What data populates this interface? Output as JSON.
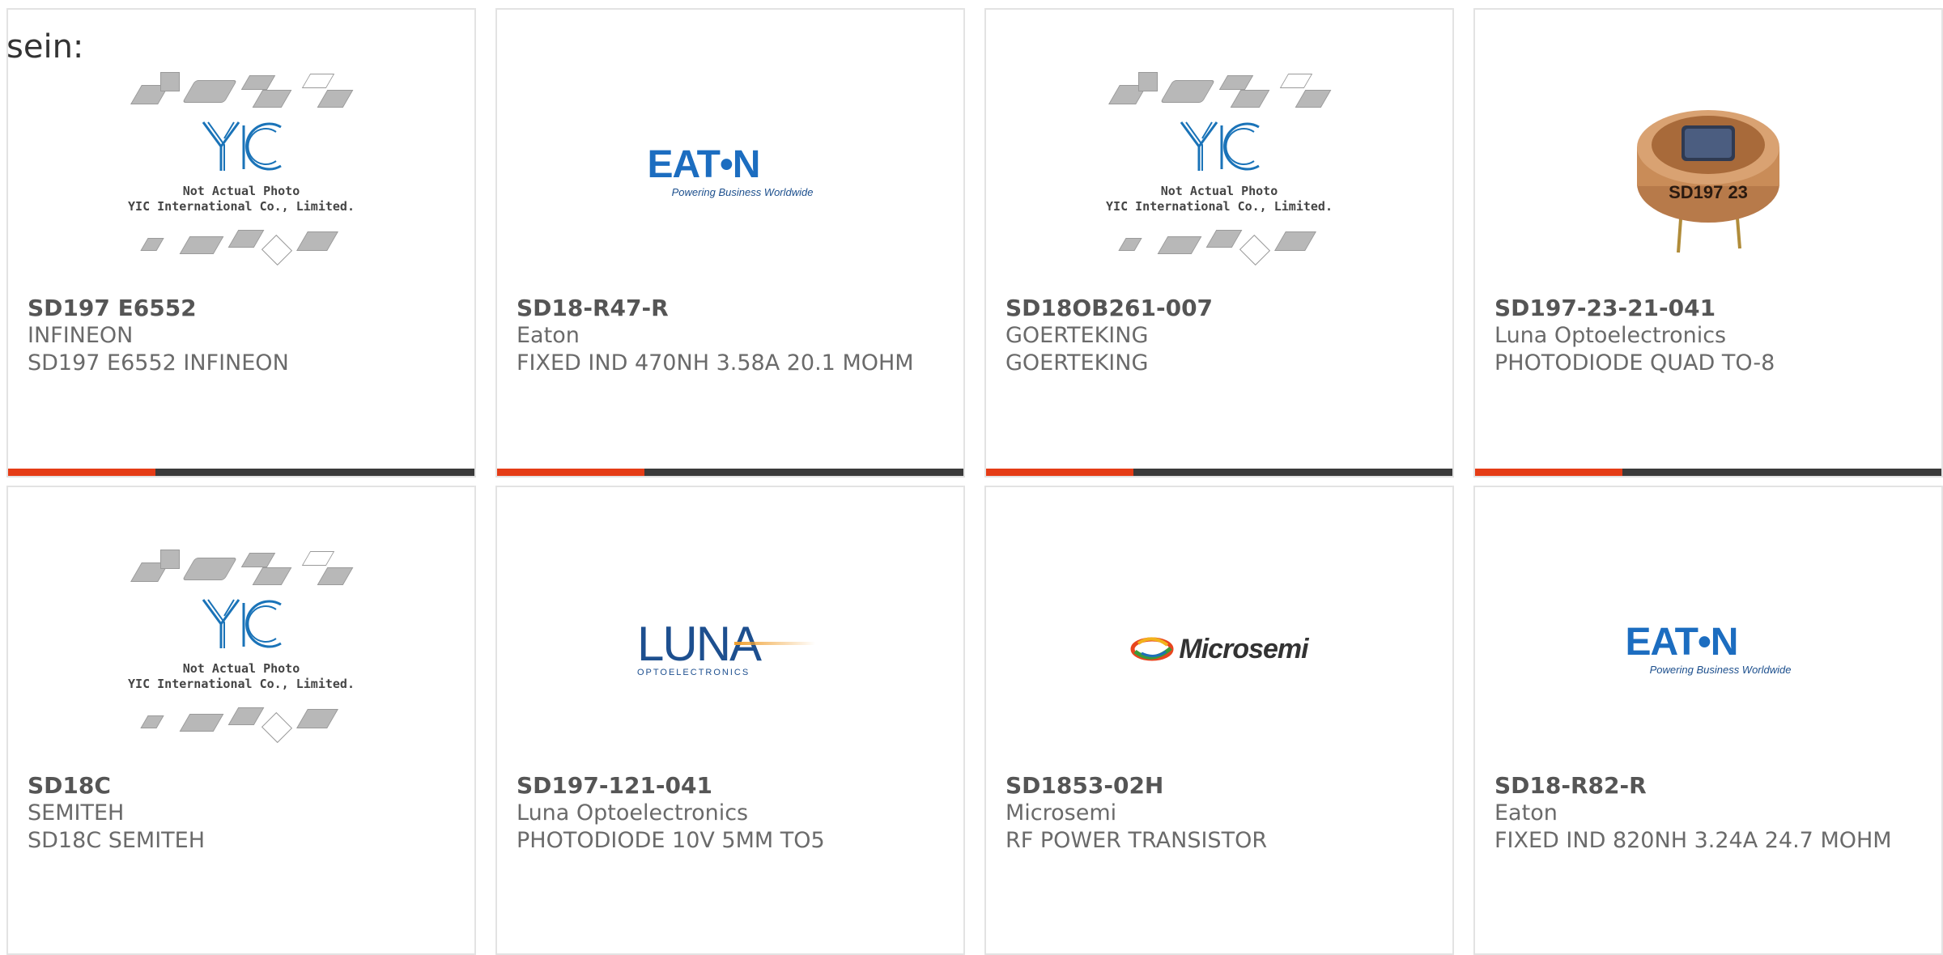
{
  "intro_text": "sein:",
  "placeholder": {
    "logo_text": "YIC",
    "line1": "Not Actual Photo",
    "line2": "YIC International Co., Limited."
  },
  "brand_logos": {
    "eaton_word": "EAT•N",
    "eaton_tagline": "Powering Business Worldwide",
    "luna_word": "LUNA",
    "luna_sub": "OPTOELECTRONICS",
    "microsemi_word": "Microsemi"
  },
  "colors": {
    "accent": "#e53c16",
    "bar": "#3a3a3a",
    "eaton_blue": "#1c6dc0",
    "yic_blue": "#1a73b8"
  },
  "products": [
    {
      "part_number": "SD197 E6552",
      "manufacturer": "INFINEON",
      "description": "SD197 E6552 INFINEON",
      "image": "placeholder"
    },
    {
      "part_number": "SD18-R47-R",
      "manufacturer": "Eaton",
      "description": "FIXED IND 470NH 3.58A 20.1 MOHM",
      "image": "eaton-logo"
    },
    {
      "part_number": "SD18OB261-007",
      "manufacturer": "GOERTEKING",
      "description": "GOERTEKING",
      "image": "placeholder"
    },
    {
      "part_number": "SD197-23-21-041",
      "manufacturer": "Luna Optoelectronics",
      "description": "PHOTODIODE QUAD TO-8",
      "image": "photodiode-photo"
    },
    {
      "part_number": "SD18C",
      "manufacturer": "SEMITEH",
      "description": "SD18C SEMITEH",
      "image": "placeholder"
    },
    {
      "part_number": "SD197-121-041",
      "manufacturer": "Luna Optoelectronics",
      "description": "PHOTODIODE 10V 5MM TO5",
      "image": "luna-logo"
    },
    {
      "part_number": "SD1853-02H",
      "manufacturer": "Microsemi",
      "description": "RF POWER TRANSISTOR",
      "image": "microsemi-logo"
    },
    {
      "part_number": "SD18-R82-R",
      "manufacturer": "Eaton",
      "description": "FIXED IND 820NH 3.24A 24.7 MOHM",
      "image": "eaton-logo"
    }
  ],
  "photodiode_label": "SD197 23"
}
